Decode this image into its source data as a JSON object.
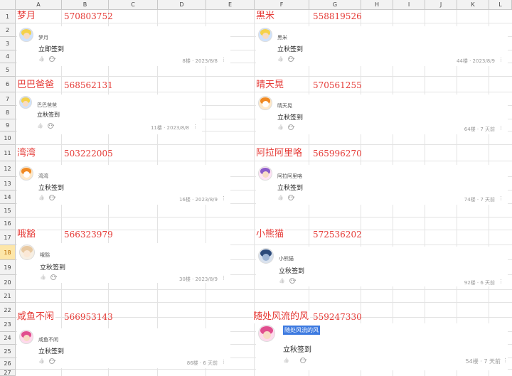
{
  "columns": [
    "A",
    "B",
    "C",
    "D",
    "E",
    "F",
    "G",
    "H",
    "I",
    "J",
    "K",
    "L"
  ],
  "rows": [
    "1",
    "2",
    "3",
    "4",
    "5",
    "6",
    "7",
    "8",
    "9",
    "10",
    "11",
    "12",
    "13",
    "14",
    "15",
    "16",
    "17",
    "18",
    "19",
    "20",
    "21",
    "22",
    "23",
    "24",
    "25",
    "26",
    "27"
  ],
  "selected_row": "18",
  "entries": [
    {
      "name": "梦月",
      "qq": "570803752",
      "user": "梦月",
      "msg": "立即签到",
      "meta": "8楼 · 2023/8/8",
      "avatar": "blonde-girl"
    },
    {
      "name": "黑米",
      "qq": "558819526",
      "user": "黑米",
      "msg": "立秋签到",
      "meta": "44楼 · 2023/8/9",
      "avatar": "blonde-girl"
    },
    {
      "name": "巴巴爸爸",
      "qq": "568562131",
      "user": "巴巴爸爸",
      "msg": "立秋签到",
      "meta": "11楼 · 2023/8/8",
      "avatar": "blonde-girl"
    },
    {
      "name": "晴天晃",
      "qq": "570561255",
      "user": "晴天晃",
      "msg": "立秋签到",
      "meta": "64楼 · 7 天前",
      "avatar": "fox"
    },
    {
      "name": "湾湾",
      "qq": "503222005",
      "user": "湾湾",
      "msg": "立秋签到",
      "meta": "16楼 · 2023/8/9",
      "avatar": "fox"
    },
    {
      "name": "阿拉阿里咯",
      "qq": "565996270",
      "user": "阿拉阿里咯",
      "msg": "立秋签到",
      "meta": "74楼 · 7 天前",
      "avatar": "purple-girl"
    },
    {
      "name": "哦豁",
      "qq": "566323979",
      "user": "哦豁",
      "msg": "立秋签到",
      "meta": "30楼 · 2023/8/9",
      "avatar": "anime-girl"
    },
    {
      "name": "小熊猫",
      "qq": "572536202",
      "user": "小熊猫",
      "msg": "立秋签到",
      "meta": "92楼 · 6 天前",
      "avatar": "robot"
    },
    {
      "name": "咸鱼不闲",
      "qq": "566953143",
      "user": "咸鱼不闲",
      "msg": "立秋签到",
      "meta": "86楼 · 6 天前",
      "avatar": "pink-girl"
    },
    {
      "name": "随处风流的风",
      "qq": "559247330",
      "user": "随处风流的风",
      "msg": "立秋签到",
      "meta": "54楼 · 7 天前",
      "avatar": "pink-girl"
    }
  ],
  "icons": {
    "like": "thumbs-up-icon",
    "reply": "comment-icon",
    "more": "more-dots-icon"
  },
  "colors": {
    "name_red": "#e53935",
    "selection_blue": "#3d7ae0",
    "header_bg": "#f2f2f2",
    "selected_row_header": "#fde6a8"
  }
}
